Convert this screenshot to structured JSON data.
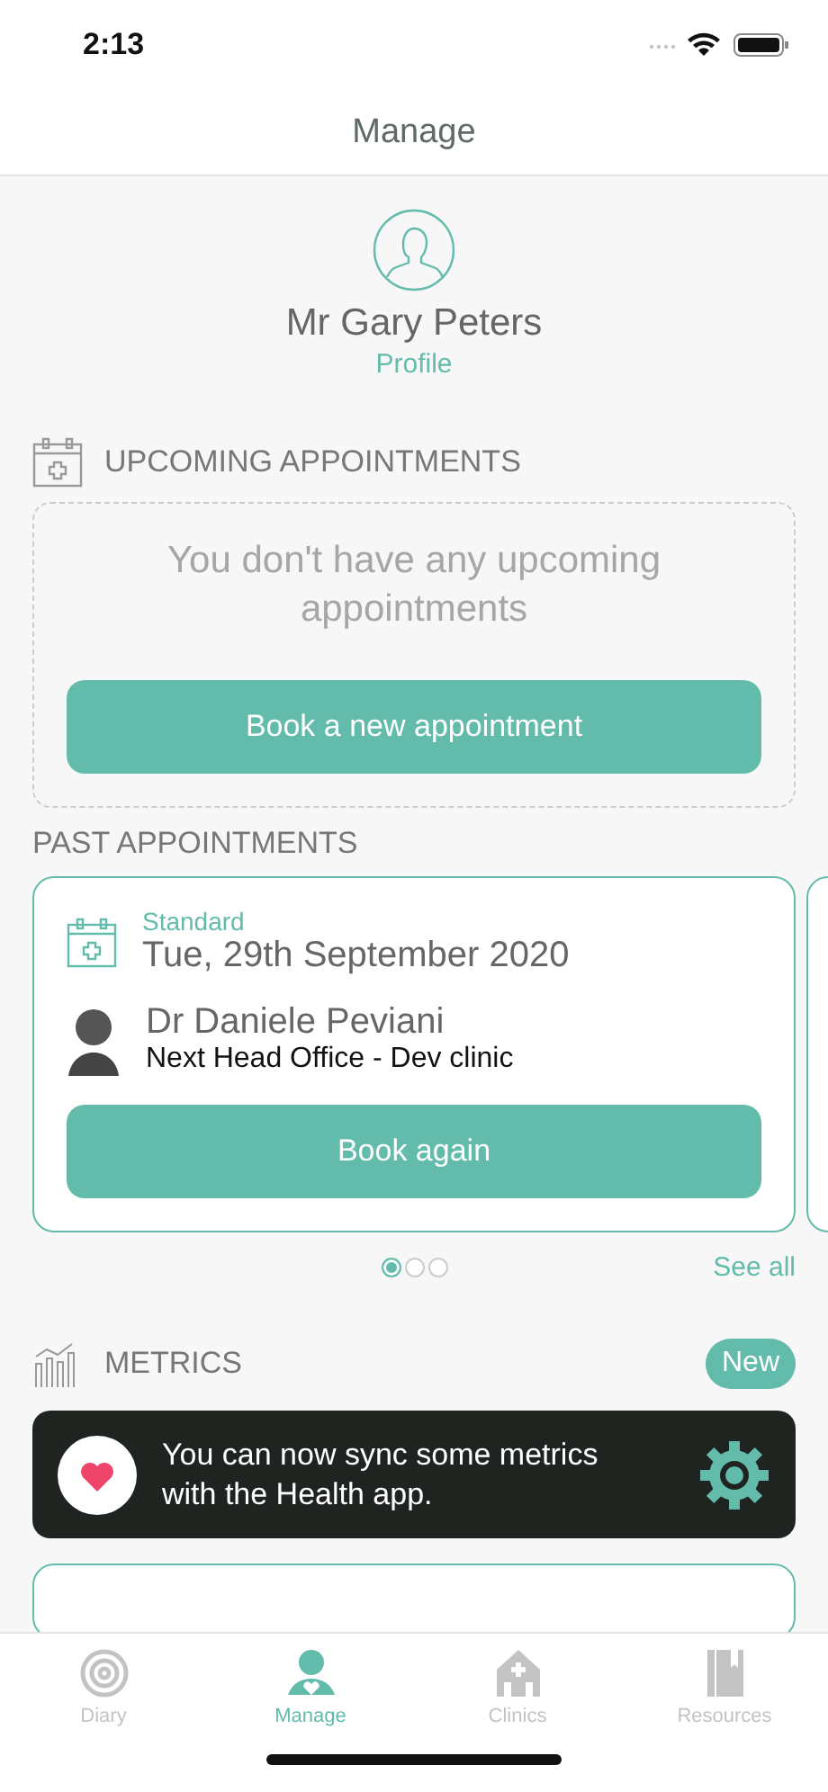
{
  "status_bar": {
    "time": "2:13"
  },
  "nav": {
    "title": "Manage"
  },
  "profile": {
    "name": "Mr Gary Peters",
    "link": "Profile"
  },
  "upcoming": {
    "heading": "UPCOMING APPOINTMENTS",
    "empty_message": "You don't have any upcoming appointments",
    "button": "Book a new appointment"
  },
  "past": {
    "heading": "PAST APPOINTMENTS",
    "cards": [
      {
        "type": "Standard",
        "date": "Tue, 29th September 2020",
        "doctor": "Dr Daniele Peviani",
        "clinic": "Next Head Office - Dev clinic",
        "button": "Book again"
      }
    ],
    "pages": [
      {
        "selected": true
      },
      {
        "selected": false
      },
      {
        "selected": false
      }
    ],
    "see_all": "See all"
  },
  "metrics": {
    "heading": "METRICS",
    "badge": "New",
    "banner": "You can now sync some metrics with the Health app."
  },
  "tabs": [
    {
      "label": "Diary",
      "selected": false,
      "kind": "target"
    },
    {
      "label": "Manage",
      "selected": true,
      "kind": "person"
    },
    {
      "label": "Clinics",
      "selected": false,
      "kind": "clinic"
    },
    {
      "label": "Resources",
      "selected": false,
      "kind": "book"
    }
  ]
}
